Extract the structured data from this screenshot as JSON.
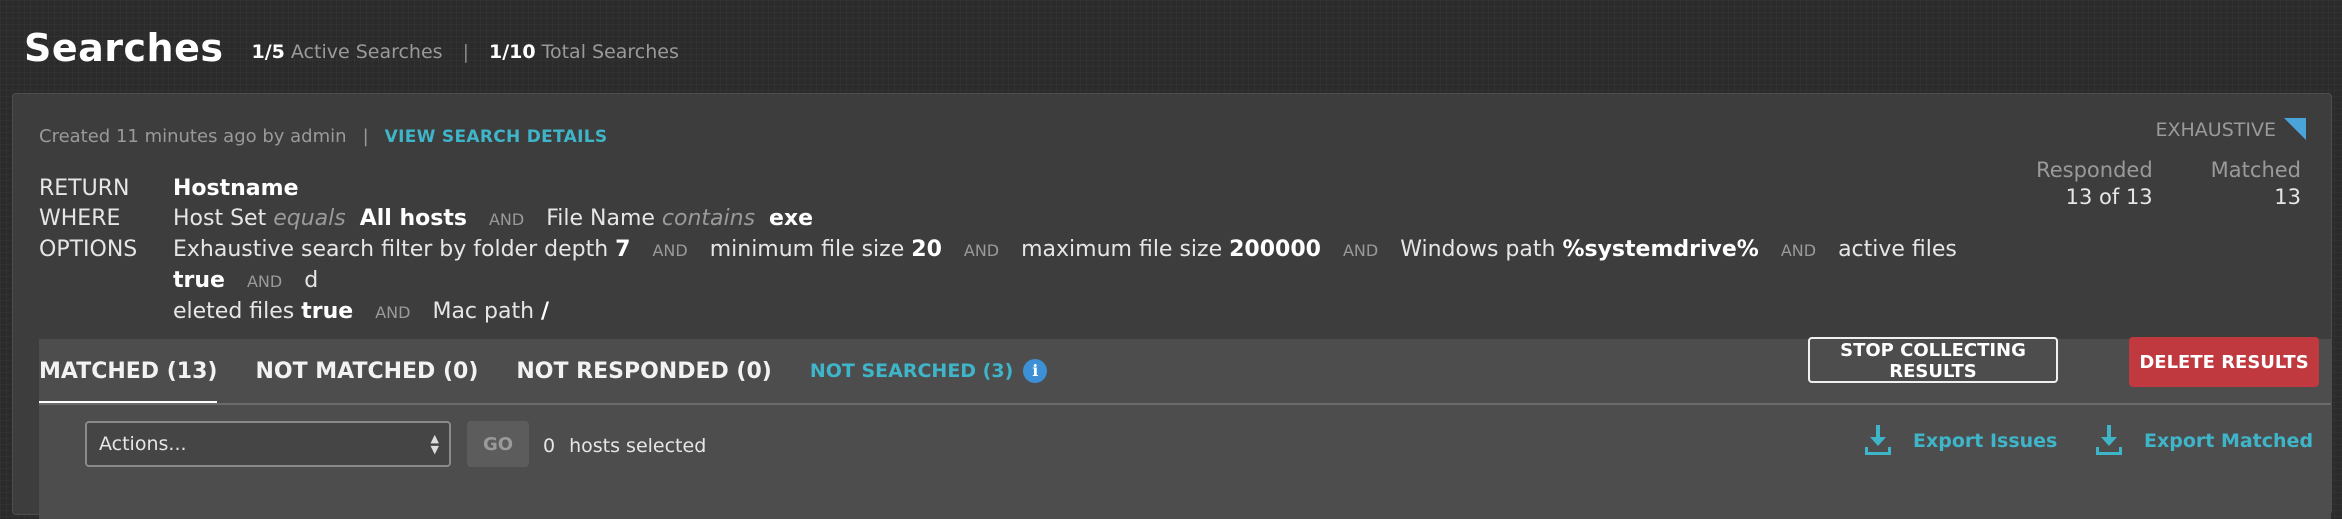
{
  "header": {
    "title": "Searches",
    "active_count": "1/5",
    "active_label": "Active Searches",
    "separator": "|",
    "total_count": "1/10",
    "total_label": "Total Searches"
  },
  "search": {
    "created": "Created 11 minutes ago by admin",
    "pipe": "|",
    "view_details": "VIEW SEARCH DETAILS",
    "mode": "EXHAUSTIVE",
    "responded_label": "Responded",
    "responded_value": "13 of 13",
    "matched_label": "Matched",
    "matched_value": "13",
    "return_key": "RETURN",
    "return_value": "Hostname",
    "where_key": "WHERE",
    "where": {
      "field1": "Host Set",
      "op1": "equals",
      "val1": "All hosts",
      "and": "AND",
      "field2": "File Name",
      "op2": "contains",
      "val2": "exe"
    },
    "options_key": "OPTIONS",
    "options": {
      "t1": "Exhaustive search filter by folder depth",
      "v1": "7",
      "t2": "minimum file size",
      "v2": "20",
      "t3": "maximum file size",
      "v3": "200000",
      "t4": "Windows path",
      "v4": "%systemdrive%",
      "t5": "active files",
      "v5": "true",
      "t6a": "d",
      "t6b": "eleted files",
      "v6": "true",
      "t7": "Mac path",
      "v7": "/",
      "and": "AND"
    }
  },
  "tabs": {
    "matched": "MATCHED (13)",
    "not_matched": "NOT MATCHED (0)",
    "not_responded": "NOT RESPONDED (0)",
    "not_searched": "NOT SEARCHED (3)",
    "info_glyph": "i"
  },
  "buttons": {
    "stop": "STOP COLLECTING RESULTS",
    "delete": "DELETE RESULTS",
    "go": "GO"
  },
  "toolbar": {
    "actions_selected": "Actions...",
    "selected_count": "0",
    "selected_label": "hosts selected",
    "export_issues": "Export Issues",
    "export_matched": "Export Matched"
  },
  "colors": {
    "accent": "#3fb5c9",
    "danger": "#c0393f",
    "info": "#3d8fd6"
  }
}
